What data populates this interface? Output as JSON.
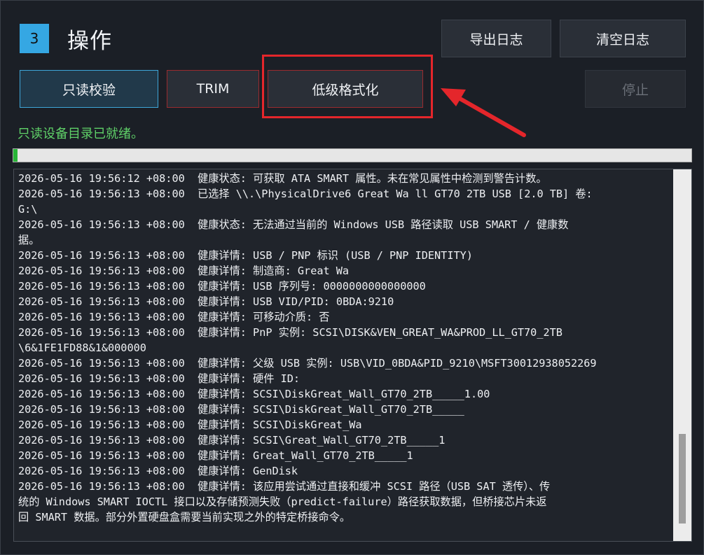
{
  "header": {
    "step_number": "3",
    "title": "操作",
    "export_log_label": "导出日志",
    "clear_log_label": "清空日志"
  },
  "actions": {
    "readonly_verify_label": "只读校验",
    "trim_label": "TRIM",
    "low_level_format_label": "低级格式化",
    "stop_label": "停止"
  },
  "status": {
    "text": "只读设备目录已就绪。",
    "progress": 0.006
  },
  "log": {
    "lines": [
      "2026-05-16 19:56:12 +08:00  健康状态: 可获取 ATA SMART 属性。未在常见属性中检测到警告计数。",
      "2026-05-16 19:56:13 +08:00  已选择 \\\\.\\PhysicalDrive6 Great Wa ll GT70 2TB USB [2.0 TB] 卷:",
      "G:\\",
      "2026-05-16 19:56:13 +08:00  健康状态: 无法通过当前的 Windows USB 路径读取 USB SMART / 健康数",
      "据。",
      "2026-05-16 19:56:13 +08:00  健康详情: USB / PNP 标识 (USB / PNP IDENTITY)",
      "2026-05-16 19:56:13 +08:00  健康详情: 制造商: Great Wa",
      "2026-05-16 19:56:13 +08:00  健康详情: USB 序列号: 0000000000000000",
      "2026-05-16 19:56:13 +08:00  健康详情: USB VID/PID: 0BDA:9210",
      "2026-05-16 19:56:13 +08:00  健康详情: 可移动介质: 否",
      "2026-05-16 19:56:13 +08:00  健康详情: PnP 实例: SCSI\\DISK&VEN_GREAT_WA&PROD_LL_GT70_2TB",
      "\\6&1FE1FD88&1&000000",
      "2026-05-16 19:56:13 +08:00  健康详情: 父级 USB 实例: USB\\VID_0BDA&PID_9210\\MSFT30012938052269",
      "2026-05-16 19:56:13 +08:00  健康详情: 硬件 ID:",
      "2026-05-16 19:56:13 +08:00  健康详情: SCSI\\DiskGreat_Wall_GT70_2TB_____1.00",
      "2026-05-16 19:56:13 +08:00  健康详情: SCSI\\DiskGreat_Wall_GT70_2TB_____",
      "2026-05-16 19:56:13 +08:00  健康详情: SCSI\\DiskGreat_Wa",
      "2026-05-16 19:56:13 +08:00  健康详情: SCSI\\Great_Wall_GT70_2TB_____1",
      "2026-05-16 19:56:13 +08:00  健康详情: Great_Wall_GT70_2TB_____1",
      "2026-05-16 19:56:13 +08:00  健康详情: GenDisk",
      "2026-05-16 19:56:13 +08:00  健康详情: 该应用尝试通过直接和缓冲 SCSI 路径（USB SAT 透传）、传",
      "统的 Windows SMART IOCTL 接口以及存储预测失败（predict-failure）路径获取数据，但桥接芯片未返",
      "回 SMART 数据。部分外置硬盘盒需要当前实现之外的特定桥接命令。"
    ],
    "scroll_position": 0.9
  },
  "colors": {
    "accent": "#35a7e3",
    "status_green": "#5fd068",
    "danger_border": "#9a2b2f",
    "annotation_red": "#e4262b"
  }
}
